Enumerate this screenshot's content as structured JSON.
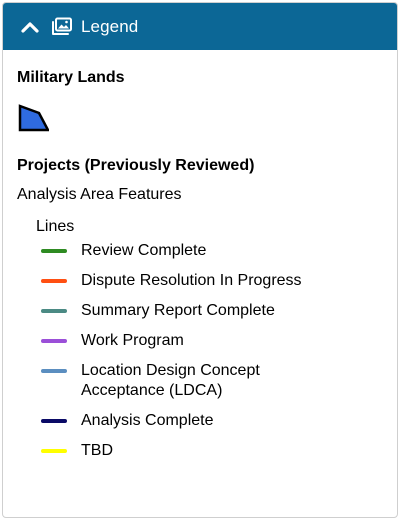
{
  "header": {
    "title": "Legend",
    "collapse_icon": "chevron-up-icon",
    "legend_icon": "image-gallery-icon",
    "background": "#0c6796"
  },
  "layers": {
    "military": {
      "title": "Military Lands",
      "symbol": {
        "shape": "polygon",
        "fill": "#2f6be0",
        "stroke": "#000000"
      }
    },
    "projects": {
      "title": "Projects (Previously Reviewed)",
      "sublayer": "Analysis Area Features",
      "group": "Lines",
      "items": [
        {
          "label": "Review Complete",
          "color": "#2e8b22"
        },
        {
          "label": "Dispute Resolution In Progress",
          "color": "#ff4f12"
        },
        {
          "label": "Summary Report Complete",
          "color": "#4b8a84"
        },
        {
          "label": "Work Program",
          "color": "#9b4fd8"
        },
        {
          "label": "Location Design Concept Acceptance (LDCA)",
          "color": "#5b8ec0"
        },
        {
          "label": "Analysis Complete",
          "color": "#0a0a66"
        },
        {
          "label": "TBD",
          "color": "#ffff00"
        }
      ]
    }
  }
}
